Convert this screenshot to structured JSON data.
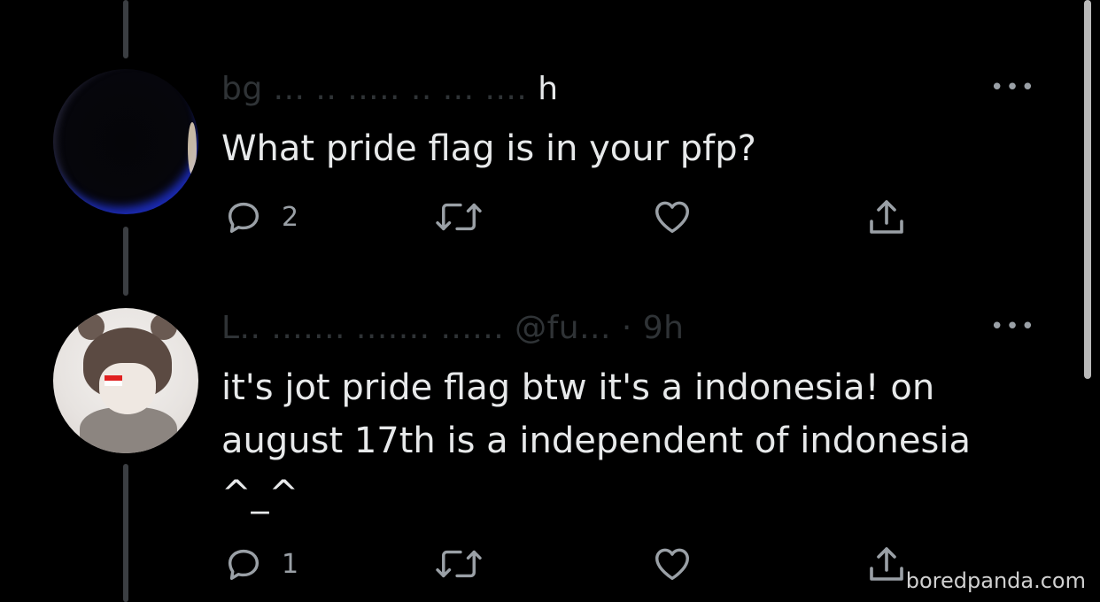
{
  "thread": [
    {
      "name_partial": "h",
      "text": "What pride flag is in your pfp?",
      "more": "•••",
      "reply_count": "2",
      "retweet_count": "",
      "like_count": ""
    },
    {
      "name_partial": "@fu... · 9h",
      "text": "it's jot pride flag btw it's a indonesia! on august 17th is a independent of indonesia ^_^",
      "more": "•••",
      "reply_count": "1",
      "retweet_count": "",
      "like_count": ""
    }
  ],
  "watermark": "boredpanda.com",
  "colors": {
    "background": "#000000",
    "text": "#e7e9ea",
    "icon": "#9aa0a6",
    "thread_line": "#3b3e42"
  },
  "icons": {
    "reply": "reply-icon",
    "retweet": "retweet-icon",
    "like": "heart-icon",
    "share": "share-icon",
    "more": "more-icon"
  }
}
